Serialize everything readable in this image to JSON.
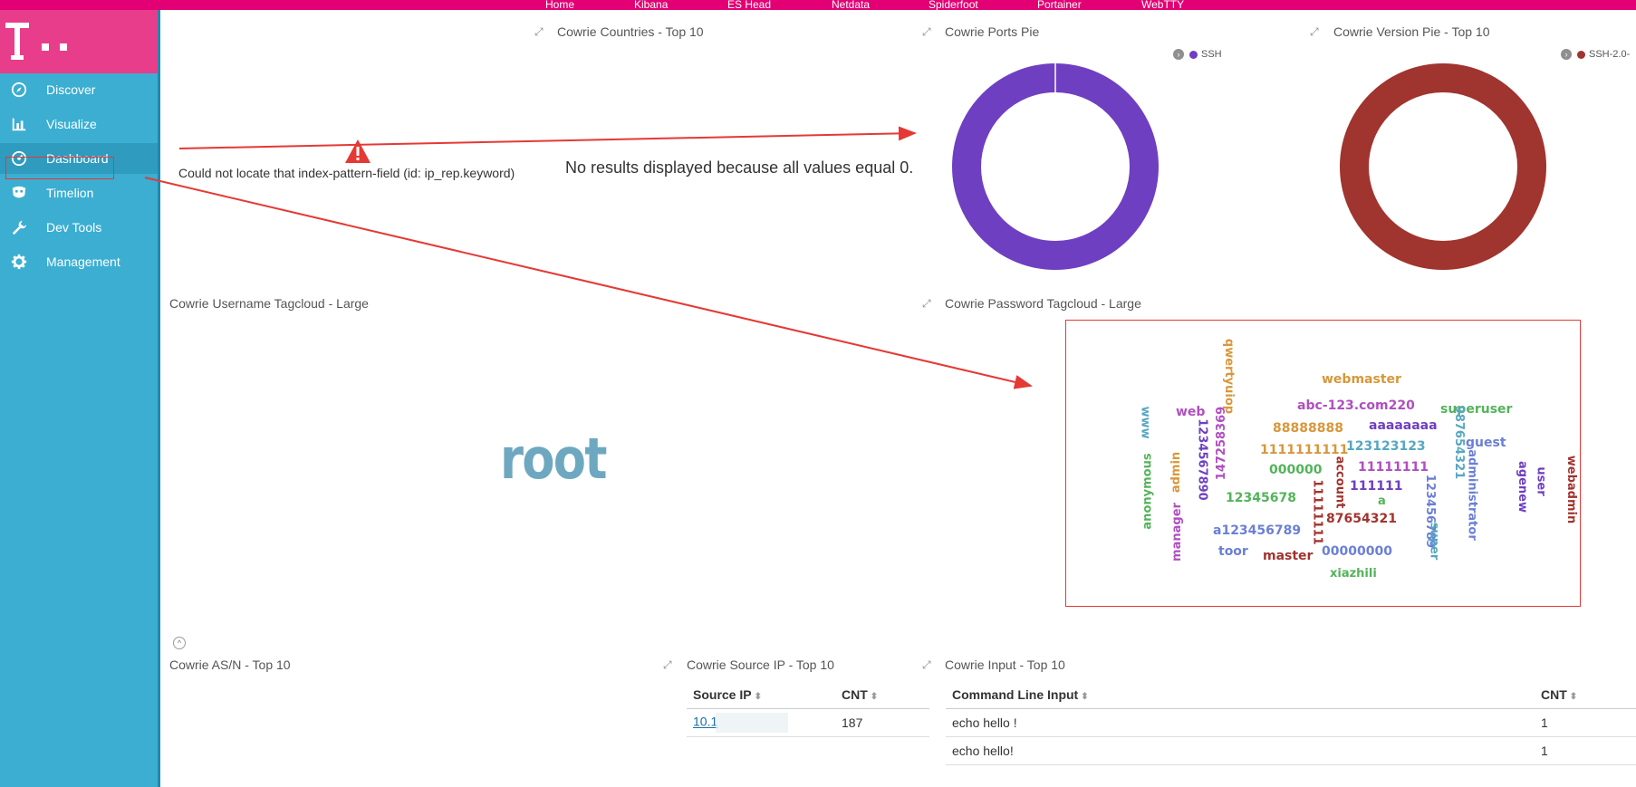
{
  "topnav": {
    "items": [
      "Home",
      "Kibana",
      "ES Head",
      "Netdata",
      "Spiderfoot",
      "Portainer",
      "WebTTY"
    ]
  },
  "sidebar": {
    "items": [
      {
        "label": "Discover",
        "icon": "compass-icon"
      },
      {
        "label": "Visualize",
        "icon": "bar-chart-icon"
      },
      {
        "label": "Dashboard",
        "icon": "dashboard-icon",
        "active": true
      },
      {
        "label": "Timelion",
        "icon": "timelion-mask-icon"
      },
      {
        "label": "Dev Tools",
        "icon": "wrench-icon"
      },
      {
        "label": "Management",
        "icon": "gear-icon"
      }
    ]
  },
  "panels": {
    "countries": {
      "title": "Cowrie Countries - Top 10",
      "error": "Could not locate that index-pattern-field (id: ip_rep.keyword)"
    },
    "ports": {
      "title": "Cowrie Ports Pie",
      "no_results": "No results displayed because all values equal 0.",
      "legend": "SSH"
    },
    "version": {
      "title": "Cowrie Version Pie - Top 10",
      "legend": "SSH-2.0-"
    },
    "username": {
      "title": "Cowrie Username Tagcloud - Large",
      "words": [
        "root"
      ]
    },
    "password": {
      "title": "Cowrie Password Tagcloud - Large",
      "words": [
        "webmaster",
        "qwertyuiop",
        "abc-123.com220",
        "superuser",
        "web",
        "www",
        "88888888",
        "aaaaaaaa",
        "147258369",
        "1234567890",
        "987654321",
        "guest",
        "1111111111",
        "123123123",
        "admin",
        "000000",
        "11111111",
        "account",
        "anonymous",
        "administrator",
        "agenew",
        "user",
        "webadmin",
        "111111",
        "12345678",
        "a",
        "123456789",
        "11111111",
        "87654321",
        "manager",
        "a123456789",
        "super",
        "toor",
        "master",
        "00000000",
        "xiazhili"
      ]
    },
    "asn": {
      "title": "Cowrie AS/N - Top 10"
    },
    "source_ip": {
      "title": "Cowrie Source IP - Top 10",
      "columns": [
        "Source IP",
        "CNT"
      ],
      "rows": [
        {
          "ip": "10.1",
          "cnt": "187"
        }
      ]
    },
    "input": {
      "title": "Cowrie Input - Top 10",
      "columns": [
        "Command Line Input",
        "CNT"
      ],
      "rows": [
        {
          "cmd": "echo hello !",
          "cnt": "1"
        },
        {
          "cmd": "echo hello!",
          "cnt": "1"
        }
      ]
    }
  },
  "colors": {
    "brand": "#e20074",
    "sidebar": "#3caed2",
    "ports_pie": "#6e3fc1",
    "version_pie": "#a0342f",
    "annotation": "#e53935"
  }
}
